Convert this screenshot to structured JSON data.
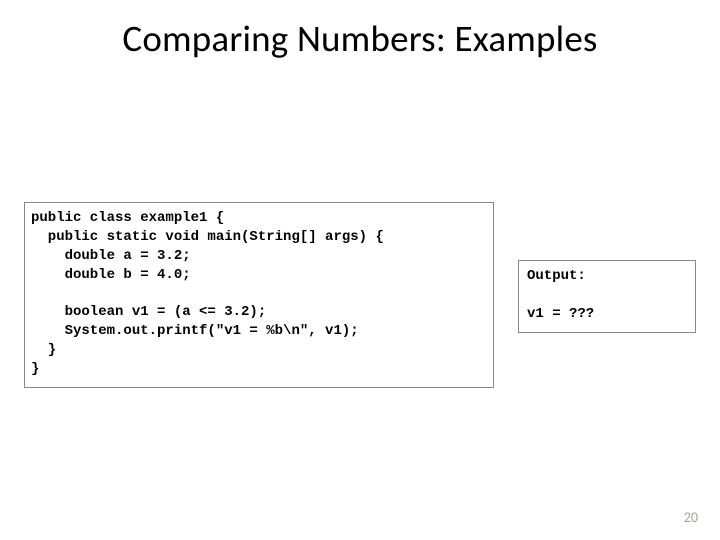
{
  "title": "Comparing Numbers: Examples",
  "code": "public class example1 {\n  public static void main(String[] args) {\n    double a = 3.2;\n    double b = 4.0;\n\n    boolean v1 = (a <= 3.2);\n    System.out.printf(\"v1 = %b\\n\", v1);\n  }\n}",
  "output": "Output:\n\nv1 = ???",
  "page_number": "20"
}
